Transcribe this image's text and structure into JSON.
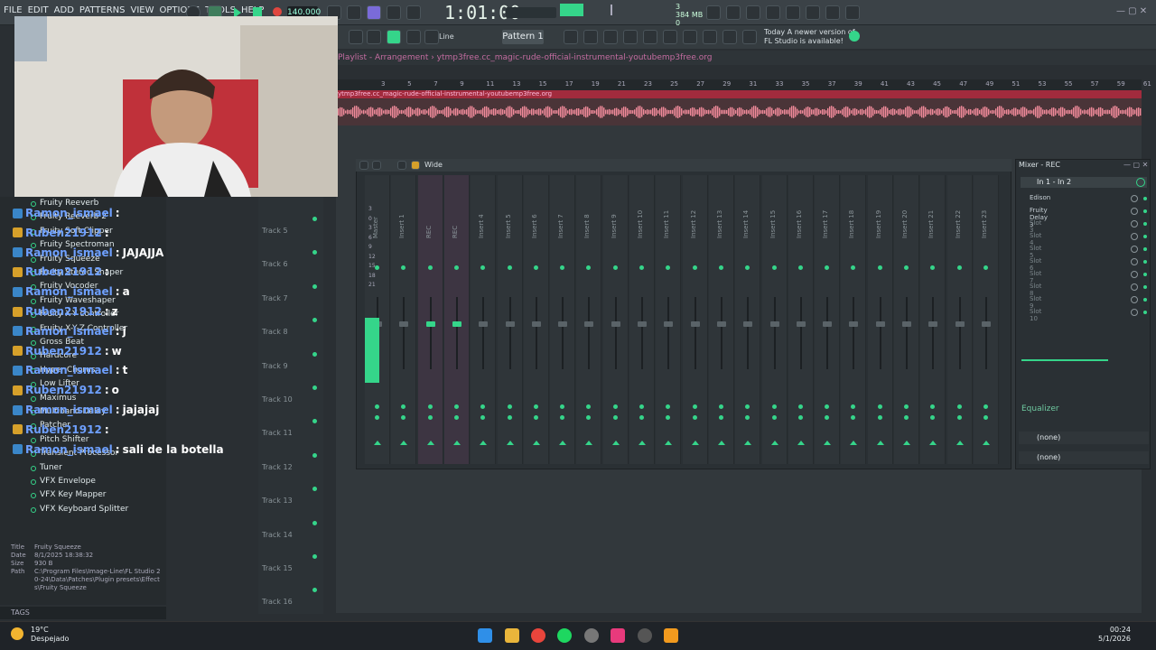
{
  "menu": [
    "FILE",
    "EDIT",
    "ADD",
    "PATTERNS",
    "VIEW",
    "OPTIONS",
    "TOOLS",
    "HELP"
  ],
  "tempo": "140.000",
  "time": "1:01:00",
  "memory": {
    "mb": "384 MB",
    "num": "3",
    "val": "0"
  },
  "snap": "Line",
  "pattern": "Pattern 1",
  "new_version": [
    "Today  A newer version of",
    "FL Studio is available!"
  ],
  "playlist_title": "Playlist - Arrangement  ›  ytmp3free.cc_magic-rude-official-instrumental-youtubemp3free.org",
  "audio_clip": "ytmp3free.cc_magic-rude-official-instrumental-youtubemp3free.org",
  "ruler": [
    "3",
    "5",
    "7",
    "9",
    "11",
    "13",
    "15",
    "17",
    "19",
    "21",
    "23",
    "25",
    "27",
    "29",
    "31",
    "33",
    "35",
    "37",
    "39",
    "41",
    "43",
    "45",
    "47",
    "49",
    "51",
    "53",
    "55",
    "57",
    "59",
    "61"
  ],
  "browser_items": [
    "Fruity Reeverb",
    "Fruity Reeverb 2",
    "Fruity Soft Clipper",
    "Fruity Spectroman",
    "Fruity Squeeze",
    "Fruity Stereo Shaper",
    "Fruity Vocoder",
    "Fruity Waveshaper",
    "Fruity X-Y controller",
    "Fruity X-Y-Z Controller",
    "Gross Beat",
    "Hardcore",
    "Hyper Chorus",
    "Low Lifter",
    "Maximus",
    "Multiband Delay",
    "Patcher",
    "Pitch Shifter",
    "Transient Processor",
    "Tuner",
    "VFX Envelope",
    "VFX Key Mapper",
    "VFX Keyboard Splitter"
  ],
  "chat": [
    {
      "user": "Ramon_ismael",
      "msg": "",
      "badge": "#3a86c8"
    },
    {
      "user": "Ruben21912",
      "msg": "",
      "badge": "#d6a02a"
    },
    {
      "user": "Ramon_ismael",
      "msg": "JAJAJJA",
      "badge": "#3a86c8"
    },
    {
      "user": "Ruben21912",
      "msg": "",
      "badge": "#d6a02a"
    },
    {
      "user": "Ramon_ismael",
      "msg": "a",
      "badge": "#3a86c8"
    },
    {
      "user": "Ruben21912",
      "msg": "z",
      "badge": "#d6a02a"
    },
    {
      "user": "Ramon_ismael",
      "msg": "j",
      "badge": "#3a86c8"
    },
    {
      "user": "Ruben21912",
      "msg": "w",
      "badge": "#d6a02a"
    },
    {
      "user": "Ramon_ismael",
      "msg": "t",
      "badge": "#3a86c8"
    },
    {
      "user": "Ruben21912",
      "msg": "o",
      "badge": "#d6a02a"
    },
    {
      "user": "Ramon_ismael",
      "msg": "jajajaj",
      "badge": "#3a86c8"
    },
    {
      "user": "Ruben21912",
      "msg": "",
      "badge": "#d6a02a"
    },
    {
      "user": "Ramon_ismael",
      "msg": "sali de la botella",
      "badge": "#3a86c8"
    }
  ],
  "info": {
    "title_label": "Title",
    "title": "Fruity Squeeze",
    "date_label": "Date",
    "date": "8/1/2025 18:38:32",
    "size_label": "Size",
    "size": "930 B",
    "path_label": "Path",
    "path": "C:\\Program Files\\Image-Line\\FL Studio 20-24\\Data\\Patches\\Plugin presets\\Effects\\Fruity Squeeze"
  },
  "tags": "TAGS",
  "tracks": [
    "Track 5",
    "Track 6",
    "Track 7",
    "Track 8",
    "Track 9",
    "Track 10",
    "Track 11",
    "Track 12",
    "Track 13",
    "Track 14",
    "Track 15",
    "Track 16"
  ],
  "mixer": {
    "view": "Wide",
    "title": "Mixer - REC",
    "routing": "In 1 - In 2",
    "strips": [
      "Master",
      "Insert 1",
      "REC",
      "REC",
      "Insert 4",
      "Insert 5",
      "Insert 6",
      "Insert 7",
      "Insert 8",
      "Insert 9",
      "Insert 10",
      "Insert 11",
      "Insert 12",
      "Insert 13",
      "Insert 14",
      "Insert 15",
      "Insert 16",
      "Insert 17",
      "Insert 18",
      "Insert 19",
      "Insert 20",
      "Insert 21",
      "Insert 22",
      "Insert 23"
    ],
    "slots": [
      "Edison",
      "Fruity Delay 3",
      "Slot 3",
      "Slot 4",
      "Slot 5",
      "Slot 6",
      "Slot 7",
      "Slot 8",
      "Slot 9",
      "Slot 10"
    ],
    "equalizer": "Equalizer",
    "none1": "(none)",
    "none2": "(none)",
    "meter_scale": [
      "3",
      "0",
      "3",
      "6",
      "9",
      "12",
      "15",
      "18",
      "21"
    ]
  },
  "taskbar": {
    "temp": "19°C",
    "weather": "Despejado",
    "time": "00:24",
    "date": "5/1/2026"
  },
  "colors": {
    "accent": "#35d58a",
    "audio": "#a22b3d",
    "chat_name": "#6ea0ff"
  }
}
